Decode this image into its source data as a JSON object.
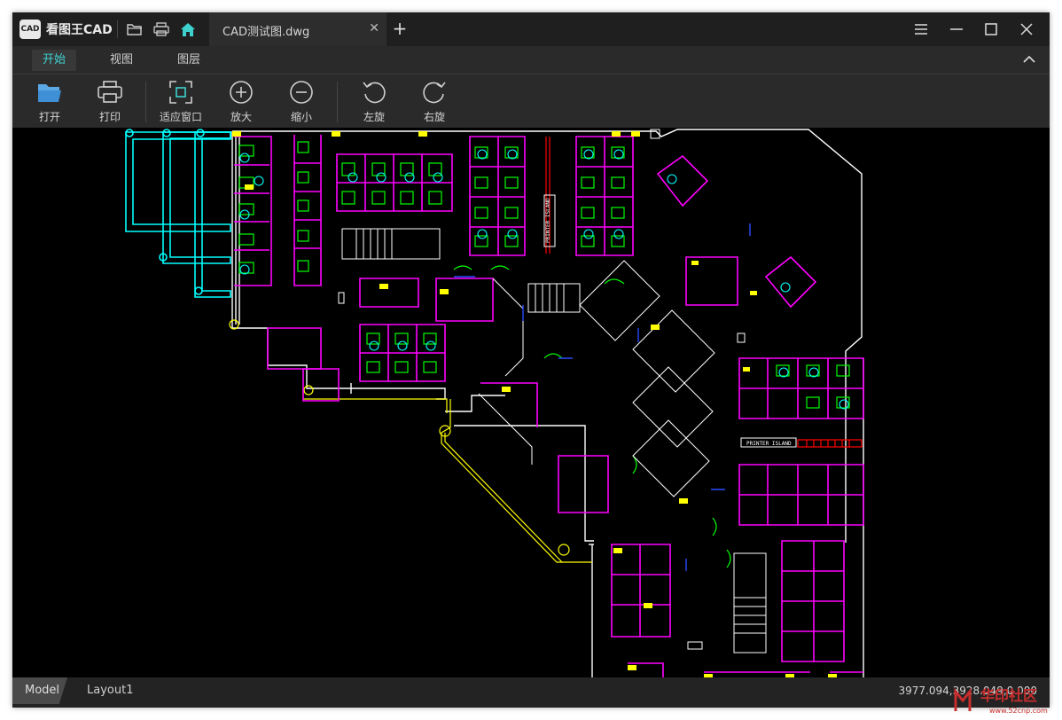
{
  "app": {
    "name": "看图王CAD",
    "logo_text": "CAD"
  },
  "tabs": [
    {
      "label": "CAD测试图.dwg"
    }
  ],
  "menu": {
    "items": [
      {
        "label": "开始",
        "active": true
      },
      {
        "label": "视图",
        "active": false
      },
      {
        "label": "图层",
        "active": false
      }
    ]
  },
  "toolbar": {
    "open": "打开",
    "print": "打印",
    "fit": "适应窗口",
    "zoom_in": "放大",
    "zoom_out": "缩小",
    "rotate_left": "左旋",
    "rotate_right": "右旋"
  },
  "drawing": {
    "labels": [
      "PRINTER ISLAND",
      "PRINTER ISLAND"
    ]
  },
  "status": {
    "model_tab": "Model",
    "layout_tab": "Layout1",
    "coordinates": "3977.094,3928.049,0.000"
  },
  "watermark": {
    "text": "华印社区",
    "url_text": "www.52cnp.com"
  },
  "colors": {
    "accent": "#3ed2cf",
    "cad_white": "#ffffff",
    "cad_magenta": "#ff00ff",
    "cad_cyan": "#00ffff",
    "cad_green": "#00ff00",
    "cad_yellow": "#ffff00",
    "cad_red": "#ff0000",
    "cad_blue": "#0000ff"
  }
}
